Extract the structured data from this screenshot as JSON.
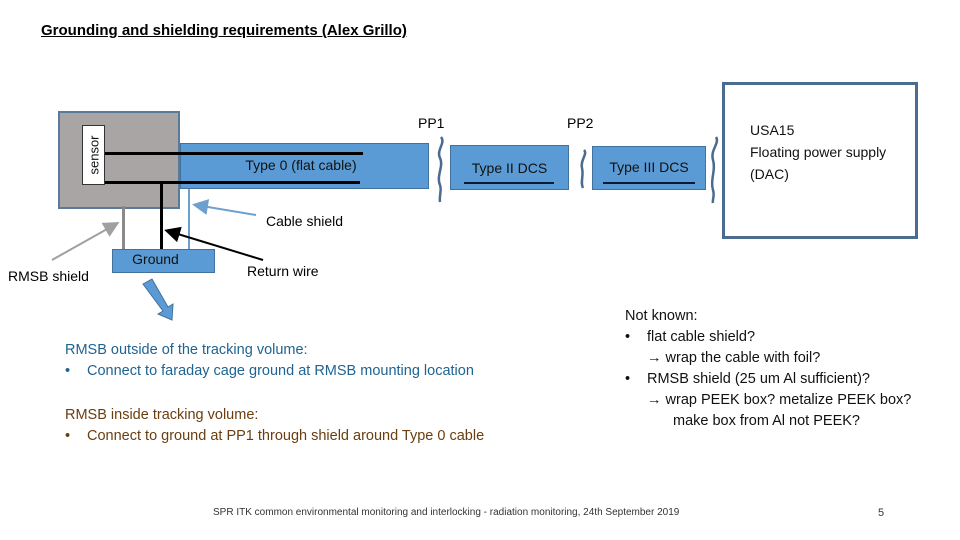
{
  "slide": {
    "title": "Grounding and shielding requirements (Alex Grillo)",
    "page_number": "5",
    "footer": "SPR ITK common environmental monitoring and interlocking - radiation monitoring, 24th September 2019"
  },
  "diagram": {
    "sensor_label": "sensor",
    "cable_type0": "Type 0 (flat cable)",
    "type2": "Type II DCS",
    "type3": "Type III DCS",
    "pp1": "PP1",
    "pp2": "PP2",
    "usa15": {
      "lines": [
        "USA15",
        "Floating power supply",
        "(DAC)"
      ]
    },
    "cable_shield": "Cable shield",
    "ground": "Ground",
    "rmsb_shield": "RMSB shield",
    "return_wire": "Return wire",
    "colors": {
      "cable_blue": "#5b9bd5",
      "sensor_grey": "#a9a5a5",
      "frame_blue": "#4a6c8e",
      "text_blue": "#1f6391",
      "text_brown": "#6b3d10"
    }
  },
  "text_blocks": {
    "outside": {
      "heading": "RMSB outside of the tracking volume:",
      "bullet_symbol": "•",
      "bullet": "Connect to faraday cage ground at RMSB mounting location"
    },
    "inside": {
      "heading": "RMSB inside tracking volume:",
      "bullet_symbol": "•",
      "bullet": "Connect to ground at PP1 through shield around Type 0 cable"
    },
    "not_known": {
      "heading": "Not known:",
      "bullet_symbol": "•",
      "items": [
        {
          "text": "flat cable shield?",
          "sub": [
            "→ wrap the cable with foil?"
          ]
        },
        {
          "text": "RMSB shield (25 um Al sufficient)?",
          "sub": [
            "→ wrap PEEK box?  metalize PEEK box?",
            "make box from Al not PEEK?"
          ]
        }
      ]
    }
  }
}
